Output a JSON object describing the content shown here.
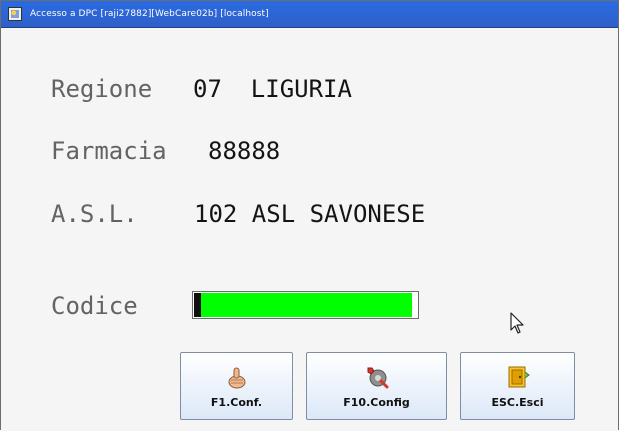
{
  "window": {
    "title": "Accesso a DPC [raji27882][WebCare02b] [localhost]"
  },
  "fields": {
    "regione": {
      "label": "Regione",
      "value": "07  LIGURIA"
    },
    "farmacia": {
      "label": "Farmacia",
      "value": "88888"
    },
    "asl": {
      "label": "A.S.L.",
      "value": "102 ASL SAVONESE"
    },
    "codice": {
      "label": "Codice",
      "progress": 0.97
    }
  },
  "buttons": [
    {
      "label": "F1.Conf.",
      "icon": "thumbs-up-icon"
    },
    {
      "label": "F10.Config",
      "icon": "wrench-icon"
    },
    {
      "label": "ESC.Esci",
      "icon": "exit-door-icon"
    }
  ],
  "colors": {
    "titlebar": "#2f66d8",
    "progress_fill": "#00ff00",
    "text_label": "#636363",
    "text_value": "#141414"
  }
}
